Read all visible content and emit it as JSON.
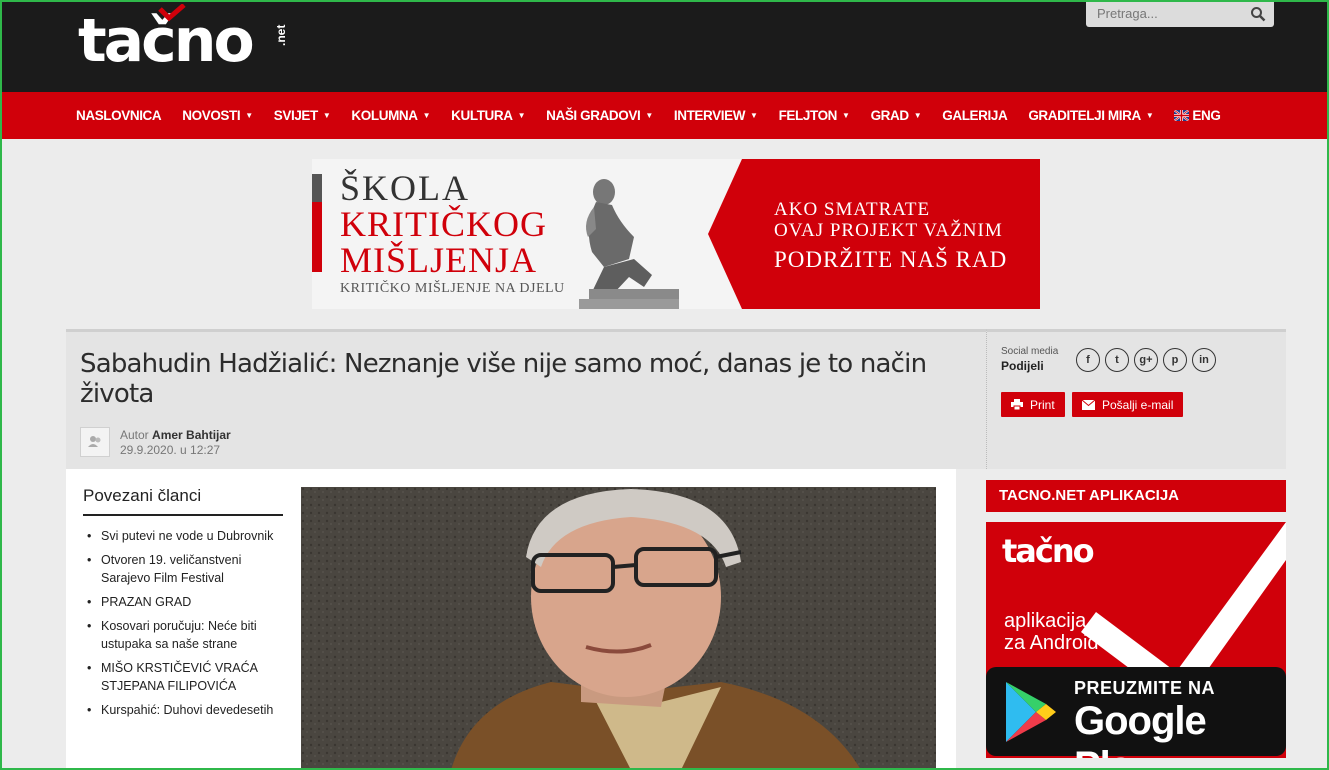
{
  "header": {
    "logo_text": "tačno",
    "logo_suffix": ".net",
    "search_placeholder": "Pretraga..."
  },
  "nav": {
    "items": [
      {
        "label": "NASLOVNICA",
        "caret": false
      },
      {
        "label": "NOVOSTI",
        "caret": true
      },
      {
        "label": "SVIJET",
        "caret": true
      },
      {
        "label": "KOLUMNA",
        "caret": true
      },
      {
        "label": "KULTURA",
        "caret": true
      },
      {
        "label": "NAŠI GRADOVI",
        "caret": true
      },
      {
        "label": "INTERVIEW",
        "caret": true
      },
      {
        "label": "FELJTON",
        "caret": true
      },
      {
        "label": "GRAD",
        "caret": true
      },
      {
        "label": "GALERIJA",
        "caret": false
      },
      {
        "label": "GRADITELJI MIRA",
        "caret": true
      }
    ],
    "lang_label": "ENG",
    "caret_glyph": "▼"
  },
  "banner": {
    "line1": "ŠKOLA",
    "line2": "KRITIČKOG",
    "line3": "MIŠLJENJA",
    "subline": "KRITIČKO MIŠLJENJE NA DJELU",
    "cta1": "AKO SMATRATE",
    "cta2": "OVAJ PROJEKT VAŽNIM",
    "cta3": "PODRŽITE NAŠ RAD"
  },
  "article": {
    "title": "Sabahudin Hadžialić: Neznanje više nije samo moć, danas je to način života",
    "author_prefix": "Autor",
    "author_name": "Amer Bahtijar",
    "date": "29.9.2020. u 12:27"
  },
  "share": {
    "label_top": "Social media",
    "label_bottom": "Podijeli",
    "icons": [
      "f",
      "t",
      "g+",
      "p",
      "in"
    ],
    "print_label": "Print",
    "email_label": "Pošalji e-mail"
  },
  "related": {
    "title": "Povezani članci",
    "items": [
      "Svi putevi ne vode u Dubrovnik",
      "Otvoren 19. veličanstveni Sarajevo Film Festival",
      "PRAZAN GRAD",
      "Kosovari poručuju: Neće biti ustupaka sa naše strane",
      "MIŠO KRSTIČEVIĆ VRAĆA STJEPANA FILIPOVIĆA",
      "Kurspahić: Duhovi devedesetih"
    ]
  },
  "sidebar": {
    "app_heading": "TACNO.NET APLIKACIJA",
    "app_logo": "tačno",
    "app_line1": "aplikacija",
    "app_line2": "za Android",
    "gp_line1": "PREUZMITE NA",
    "gp_line2": "Google Play"
  },
  "colors": {
    "brand_red": "#d0000a",
    "header_dark": "#1b1b1b"
  }
}
